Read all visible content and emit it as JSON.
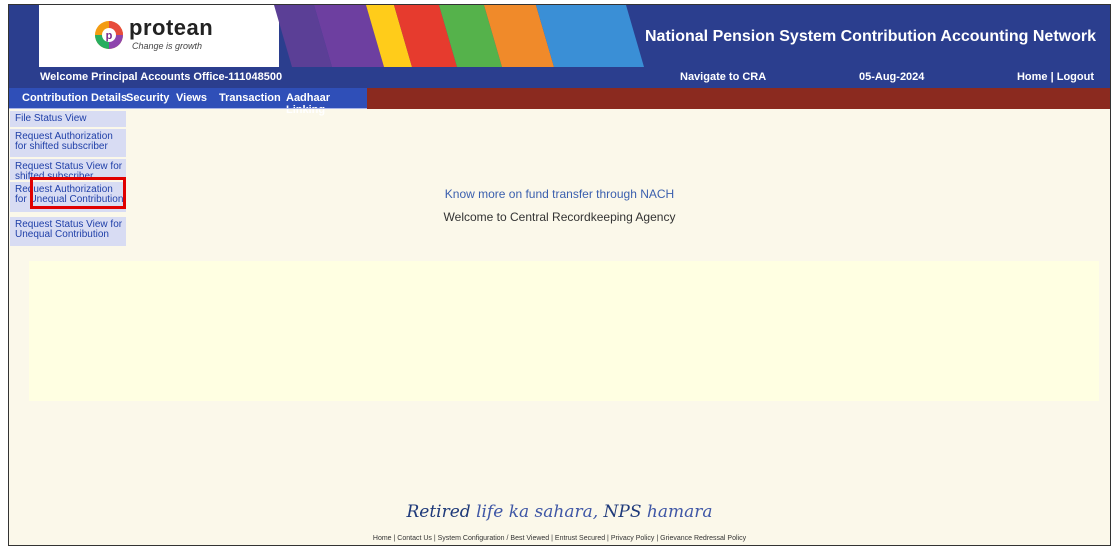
{
  "header": {
    "logo_text": "protean",
    "logo_tagline": "Change is growth",
    "site_title": "National Pension System Contribution Accounting Network"
  },
  "welcome_bar": {
    "welcome_text": "Welcome Principal Accounts Office-111048500",
    "navigate_label": "Navigate to CRA",
    "date": "05-Aug-2024",
    "home_label": "Home",
    "separator": " | ",
    "logout_label": "Logout"
  },
  "menu": {
    "items": [
      {
        "label": "Contribution Details"
      },
      {
        "label": "Security"
      },
      {
        "label": "Views"
      },
      {
        "label": "Transaction"
      },
      {
        "label": "Aadhaar Linking"
      }
    ]
  },
  "submenu": {
    "items": [
      {
        "label": "File Status View"
      },
      {
        "label": "Request Authorization for shifted subscriber"
      },
      {
        "label": "Request Status View for shifted subscriber"
      },
      {
        "label": "Request Authorization for Unequal Contribution"
      },
      {
        "label": "Request Status View for Unequal Contribution"
      }
    ]
  },
  "main": {
    "nach_link": "Know more on fund transfer through NACH",
    "welcome_cra": "Welcome to Central Recordkeeping Agency"
  },
  "tagline": {
    "part1": "Retired ",
    "part2": "life ka sahara, ",
    "part3": "NPS ",
    "part4": "hamara"
  },
  "footer": {
    "links": [
      "Home",
      "Contact Us",
      "System Configuration / Best Viewed",
      "Entrust Secured",
      "Privacy Policy",
      "Grievance Redressal Policy"
    ],
    "separator": " | "
  },
  "colors": {
    "header_blue": "#2b3e8e",
    "menu_blue": "#2f4fb8",
    "menu_maroon": "#8b2a1f",
    "highlight_red": "#e00000",
    "page_bg": "#fbf8ea"
  }
}
